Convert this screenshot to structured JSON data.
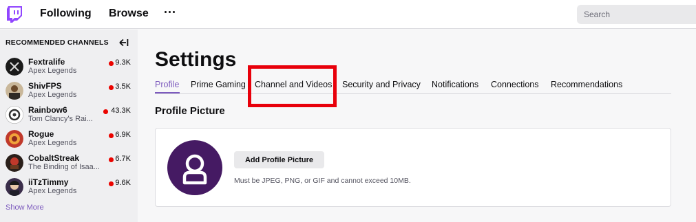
{
  "topnav": {
    "following": "Following",
    "browse": "Browse",
    "search_placeholder": "Search",
    "brand_color": "#9146ff"
  },
  "sidebar": {
    "header": "RECOMMENDED CHANNELS",
    "channels": [
      {
        "name": "Fextralife",
        "game": "Apex Legends",
        "viewers": "9.3K"
      },
      {
        "name": "ShivFPS",
        "game": "Apex Legends",
        "viewers": "3.5K"
      },
      {
        "name": "Rainbow6",
        "game": "Tom Clancy's Rai...",
        "viewers": "43.3K"
      },
      {
        "name": "Rogue",
        "game": "Apex Legends",
        "viewers": "6.9K"
      },
      {
        "name": "CobaltStreak",
        "game": "The Binding of Isaa...",
        "viewers": "6.7K"
      },
      {
        "name": "iiTzTimmy",
        "game": "Apex Legends",
        "viewers": "9.6K"
      }
    ],
    "show_more": "Show More"
  },
  "settings": {
    "title": "Settings",
    "tabs": [
      "Profile",
      "Prime Gaming",
      "Channel and Videos",
      "Security and Privacy",
      "Notifications",
      "Connections",
      "Recommendations"
    ],
    "active_tab": "Profile",
    "highlighted_tab": "Channel and Videos",
    "accent_color": "#7d5bbe",
    "highlight_color": "#e8000b"
  },
  "profile_picture": {
    "section_title": "Profile Picture",
    "add_button": "Add Profile Picture",
    "hint": "Must be JPEG, PNG, or GIF and cannot exceed 10MB.",
    "avatar_color": "#451a63"
  }
}
